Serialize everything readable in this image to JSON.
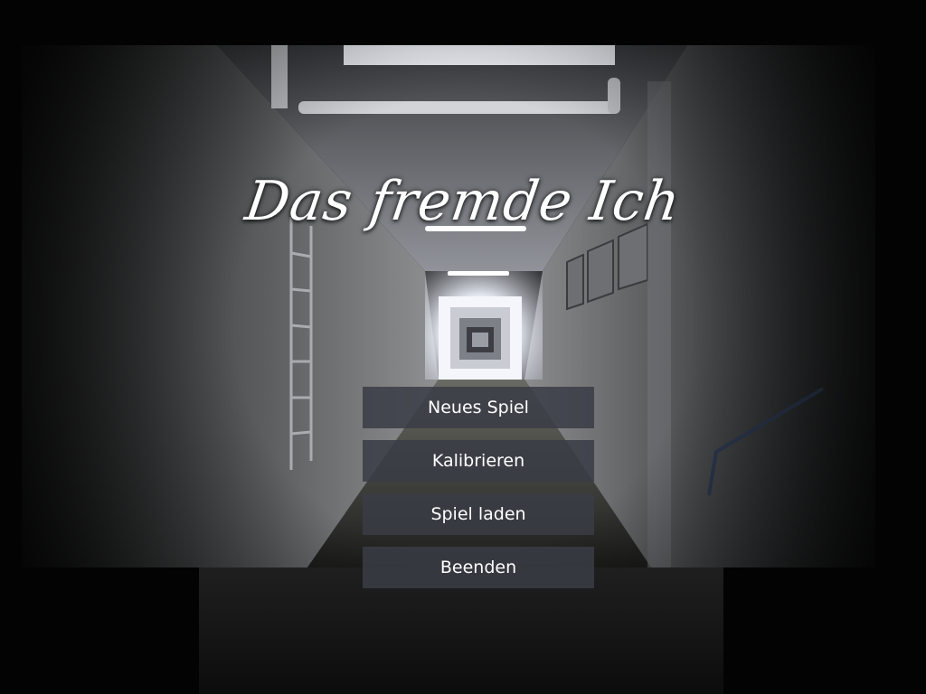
{
  "title": "Das fremde Ich",
  "menu": {
    "items": [
      {
        "label": "Neues Spiel"
      },
      {
        "label": "Kalibrieren"
      },
      {
        "label": "Spiel laden"
      },
      {
        "label": "Beenden"
      }
    ]
  },
  "colors": {
    "button_bg": "#3a3c46",
    "text": "#ffffff",
    "background": "#000000"
  }
}
